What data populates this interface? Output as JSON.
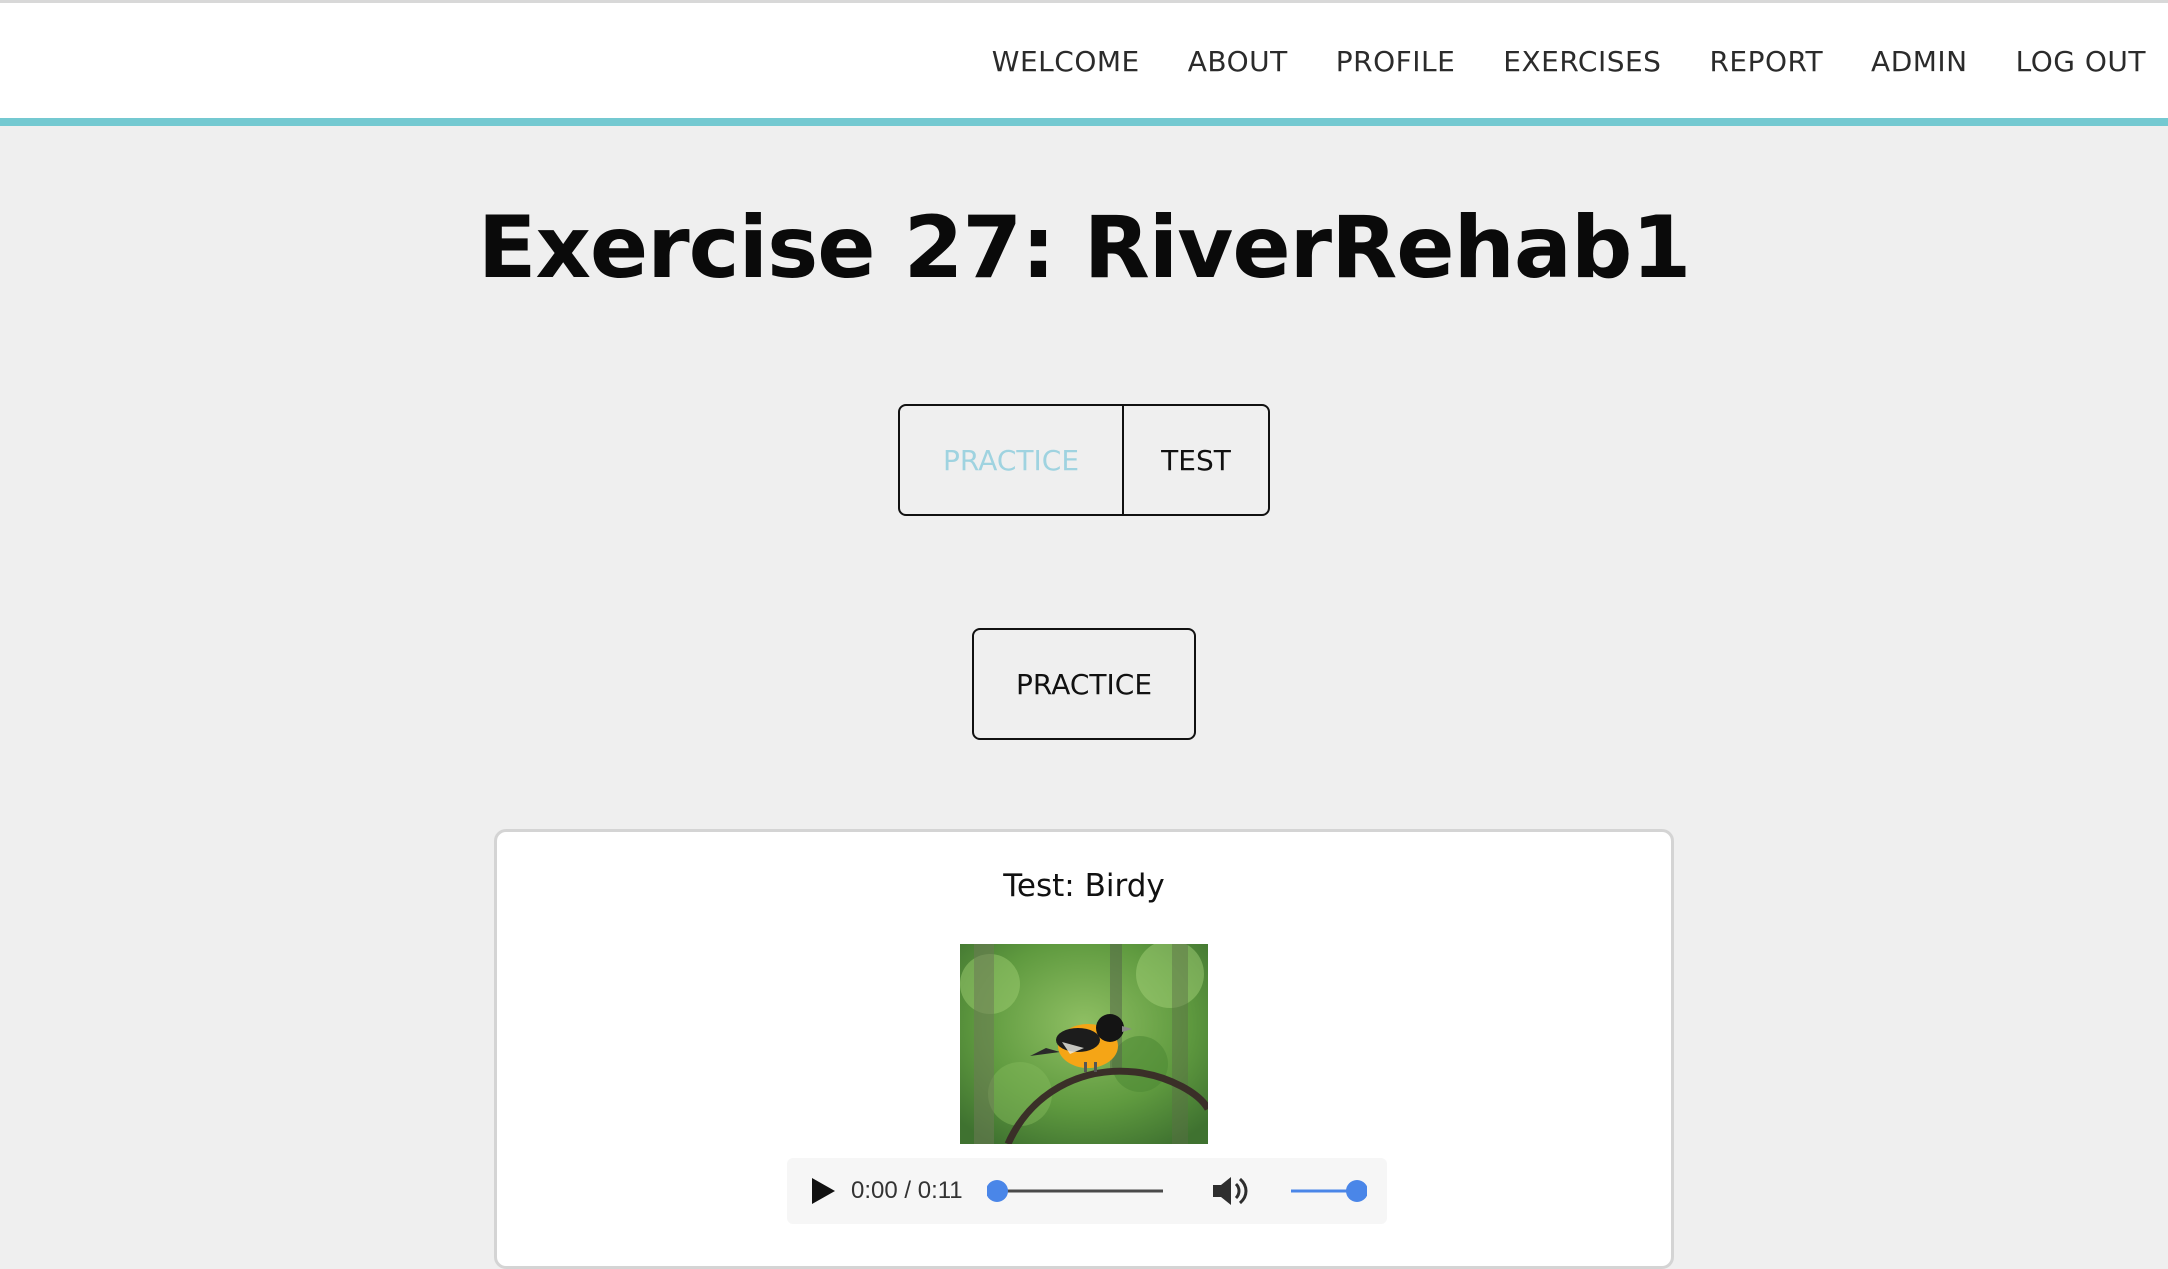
{
  "nav": {
    "items": [
      {
        "label": "WELCOME"
      },
      {
        "label": "ABOUT"
      },
      {
        "label": "PROFILE"
      },
      {
        "label": "EXERCISES"
      },
      {
        "label": "REPORT"
      },
      {
        "label": "ADMIN"
      },
      {
        "label": "LOG OUT"
      }
    ]
  },
  "page": {
    "title": "Exercise 27: RiverRehab1"
  },
  "mode_toggle": {
    "practice_label": "PRACTICE",
    "test_label": "TEST",
    "active": "PRACTICE"
  },
  "action": {
    "practice_label": "PRACTICE"
  },
  "card": {
    "title": "Test: Birdy",
    "image_subject": "oriole-bird-on-perch",
    "audio": {
      "time": "0:00 / 0:11",
      "progress_fraction": 0.0,
      "volume_fraction": 1.0
    }
  },
  "colors": {
    "accent": "#74c9d1",
    "inactive_tab": "#9fd3e0",
    "slider": "#4a86e8",
    "background": "#efefef"
  }
}
